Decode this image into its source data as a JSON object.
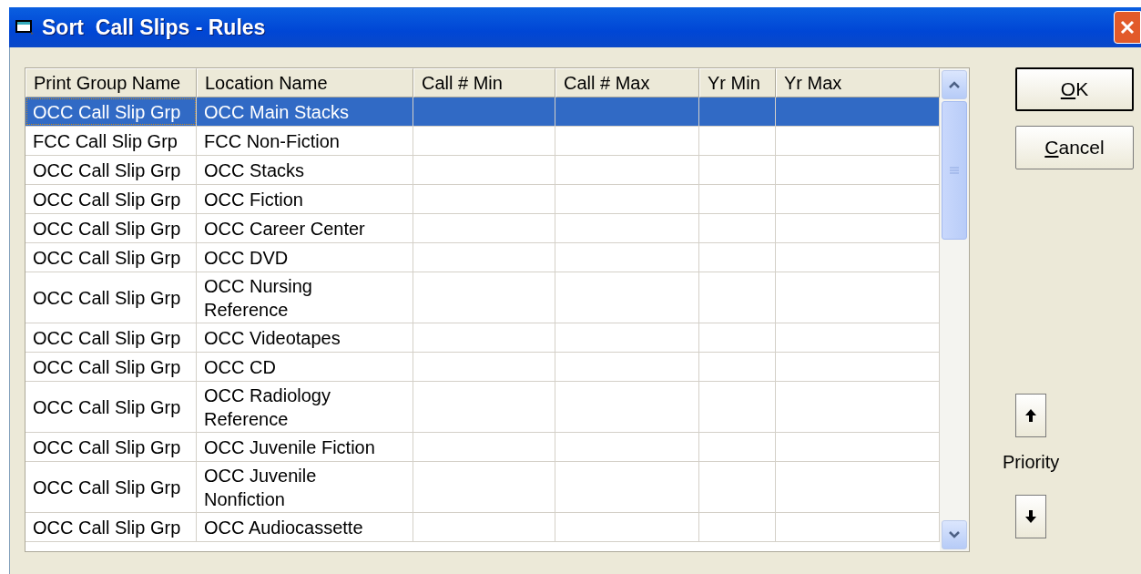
{
  "window": {
    "title": "Sort  Call Slips - Rules"
  },
  "table": {
    "columns": [
      "Print Group Name",
      "Location Name",
      "Call # Min",
      "Call # Max",
      "Yr Min",
      "Yr Max"
    ],
    "rows": [
      {
        "cells": [
          "OCC Call Slip Grp",
          "OCC Main Stacks",
          "",
          "",
          "",
          ""
        ],
        "selected": true
      },
      {
        "cells": [
          "FCC Call Slip Grp",
          "FCC Non-Fiction",
          "",
          "",
          "",
          ""
        ],
        "selected": false
      },
      {
        "cells": [
          "OCC Call Slip Grp",
          "OCC Stacks",
          "",
          "",
          "",
          ""
        ],
        "selected": false
      },
      {
        "cells": [
          "OCC Call Slip Grp",
          "OCC Fiction",
          "",
          "",
          "",
          ""
        ],
        "selected": false
      },
      {
        "cells": [
          "OCC Call Slip Grp",
          "OCC Career Center",
          "",
          "",
          "",
          ""
        ],
        "selected": false
      },
      {
        "cells": [
          "OCC Call Slip Grp",
          "OCC DVD",
          "",
          "",
          "",
          ""
        ],
        "selected": false
      },
      {
        "cells": [
          "OCC Call Slip Grp",
          "OCC Nursing Reference",
          "",
          "",
          "",
          ""
        ],
        "selected": false
      },
      {
        "cells": [
          "OCC Call Slip Grp",
          "OCC Videotapes",
          "",
          "",
          "",
          ""
        ],
        "selected": false
      },
      {
        "cells": [
          "OCC Call Slip Grp",
          "OCC CD",
          "",
          "",
          "",
          ""
        ],
        "selected": false
      },
      {
        "cells": [
          "OCC Call Slip Grp",
          "OCC Radiology Reference",
          "",
          "",
          "",
          ""
        ],
        "selected": false
      },
      {
        "cells": [
          "OCC Call Slip Grp",
          "OCC Juvenile Fiction",
          "",
          "",
          "",
          ""
        ],
        "selected": false
      },
      {
        "cells": [
          "OCC Call Slip Grp",
          "OCC Juvenile Nonfiction",
          "",
          "",
          "",
          ""
        ],
        "selected": false
      },
      {
        "cells": [
          "OCC Call Slip Grp",
          "OCC Audiocassette",
          "",
          "",
          "",
          ""
        ],
        "selected": false
      }
    ]
  },
  "buttons": [
    "OK",
    "Cancel"
  ],
  "priority_label": "Priority"
}
